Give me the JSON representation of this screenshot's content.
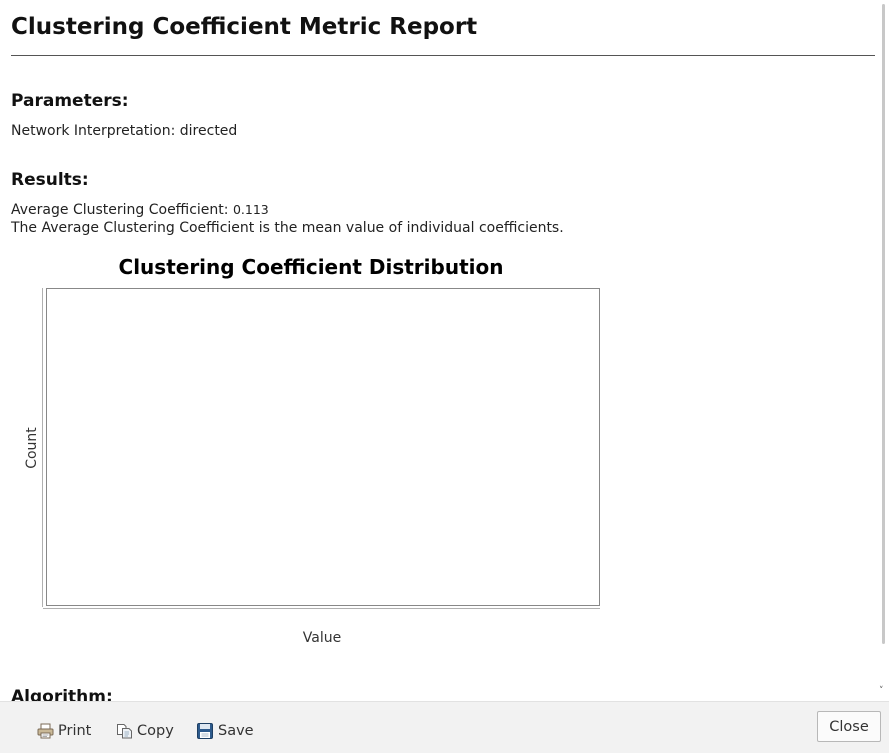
{
  "report": {
    "title": "Clustering Coefficient Metric Report"
  },
  "parameters": {
    "heading": "Parameters:",
    "network_interpretation_label": "Network Interpretation:",
    "network_interpretation_value": "directed"
  },
  "results": {
    "heading": "Results:",
    "average_label": "Average Clustering Coefficient:",
    "average_value": "0.113",
    "description": "The Average Clustering Coefficient is the mean value of individual coefficients."
  },
  "chart_data": {
    "type": "bar",
    "title": "Clustering Coefficient Distribution",
    "xlabel": "Value",
    "ylabel": "Count",
    "categories": [],
    "values": [],
    "grid": false,
    "legend": "none"
  },
  "algorithm": {
    "heading": "Algorithm:"
  },
  "toolbar": {
    "print_label": "Print",
    "copy_label": "Copy",
    "save_label": "Save",
    "close_label": "Close"
  },
  "icons": {
    "print": "printer-icon",
    "copy": "copy-icon",
    "save": "floppy-disk-icon"
  },
  "colors": {
    "chart_border": "#888888",
    "toolbar_bg": "#f2f2f2",
    "save_icon": "#2d5a8c"
  }
}
